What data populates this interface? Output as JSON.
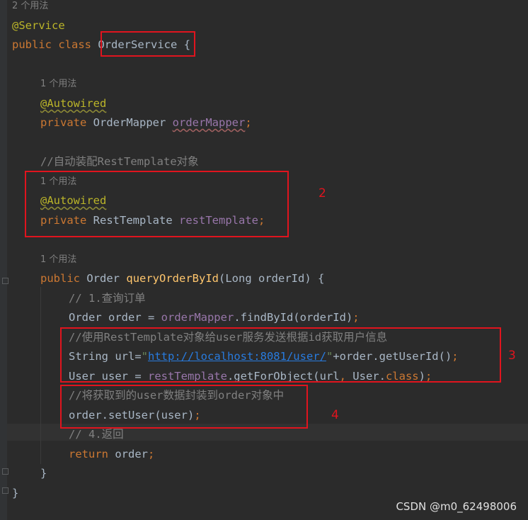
{
  "usage_hints": {
    "class": "2 个用法",
    "order_mapper": "1 个用法",
    "rest_template": "1 个用法",
    "query_method": "1 个用法"
  },
  "code": {
    "l_service_ann": "@Service",
    "l_class_public": "public",
    "l_class_kw": "class",
    "l_class_name": "OrderService",
    "l_class_brace": "{",
    "l_autowired1": "@Autowired",
    "l_private1": "private",
    "l_mapper_type": "OrderMapper",
    "l_mapper_field": "orderMapper",
    "l_semicolon1": ";",
    "l_comment_rest": "//自动装配RestTemplate对象",
    "l_autowired2": "@Autowired",
    "l_private2": "private",
    "l_rest_type": "RestTemplate",
    "l_rest_field": "restTemplate",
    "l_semicolon2": ";",
    "l_method_public": "public",
    "l_method_sig_type": "Order",
    "l_method_name": "queryOrderById",
    "l_method_params": "(Long orderId) {",
    "l_c1": "// 1.查询订单",
    "l_order_decl": "Order order = ",
    "l_order_mapper": "orderMapper",
    "l_find_call": ".findById(orderId)",
    "l_semi3": ";",
    "l_c_use": "//使用RestTemplate对象给user服务发送根据id获取用户信息",
    "l_string_decl": "String url=",
    "l_q1": "\"",
    "l_url": "http://localhost:8081/user/",
    "l_q2": "\"",
    "l_url_tail": "+order.getUserId()",
    "l_semi4": ";",
    "l_user_decl": "User user = ",
    "l_rest_ref": "restTemplate",
    "l_get_for": ".getForObject(url",
    "l_comma": ",",
    "l_user_cls": " User.",
    "l_class_kw2": "class",
    "l_close_paren": ")",
    "l_semi5": ";",
    "l_c_wrap": "//将获取到的user数据封装到order对象中",
    "l_set_user": "order.setUser(user)",
    "l_semi6": ";",
    "l_c4": "// 4.返回",
    "l_return_kw": "return",
    "l_return_val": " order",
    "l_semi7": ";",
    "l_close_method": "}",
    "l_close_class": "}"
  },
  "annotations": {
    "box2_label": "2",
    "box3_label": "3",
    "box4_label": "4"
  },
  "watermark": "CSDN @m0_62498006"
}
